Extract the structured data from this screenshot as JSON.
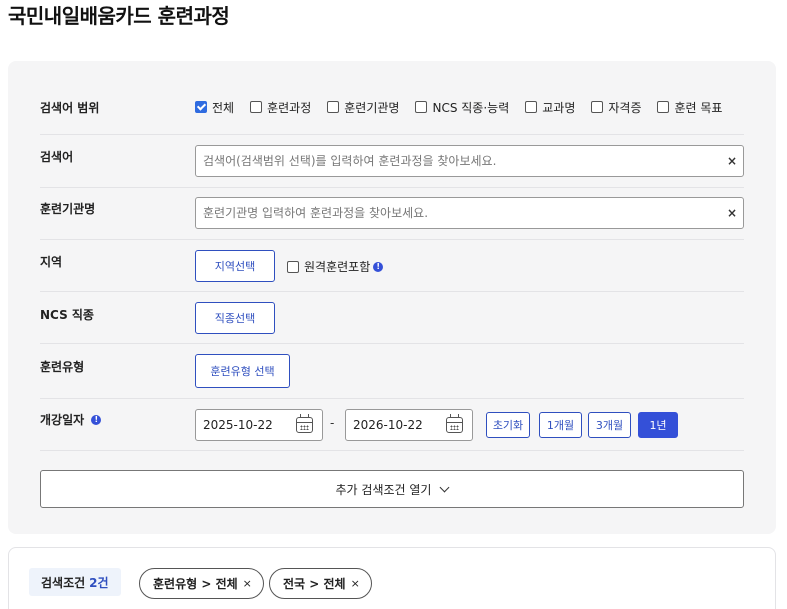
{
  "page_title": "국민내일배움카드 훈련과정",
  "search_scope": {
    "label": "검색어 범위",
    "options": [
      {
        "label": "전체",
        "checked": true
      },
      {
        "label": "훈련과정",
        "checked": false
      },
      {
        "label": "훈련기관명",
        "checked": false
      },
      {
        "label": "NCS 직종·능력",
        "checked": false
      },
      {
        "label": "교과명",
        "checked": false
      },
      {
        "label": "자격증",
        "checked": false
      },
      {
        "label": "훈련 목표",
        "checked": false
      }
    ]
  },
  "keyword": {
    "label": "검색어",
    "placeholder": "검색어(검색범위 선택)를 입력하여 훈련과정을 찾아보세요.",
    "value": "",
    "clear": "×"
  },
  "institution": {
    "label": "훈련기관명",
    "placeholder": "훈련기관명 입력하여 훈련과정을 찾아보세요.",
    "value": "",
    "clear": "×"
  },
  "region": {
    "label": "지역",
    "button": "지역선택",
    "remote_label": "원격훈련포함",
    "remote_checked": false,
    "info": "!"
  },
  "ncs": {
    "label": "NCS 직종",
    "button": "직종선택"
  },
  "training_type": {
    "label": "훈련유형",
    "button": "훈련유형 선택"
  },
  "start_date": {
    "label": "개강일자",
    "info": "!",
    "from": "2025-10-22",
    "separator": "-",
    "to": "2026-10-22",
    "periods": [
      "초기화",
      "1개월",
      "3개월",
      "1년"
    ],
    "active_period": "1년"
  },
  "more_conditions": {
    "label": "추가 검색조건 열기"
  },
  "result_conditions": {
    "label": "검색조건",
    "count": "2건",
    "chips": [
      "훈련유형 > 전체",
      "전국 > 전체"
    ],
    "chip_remove": "×"
  },
  "colors": {
    "accent": "#3450d8",
    "outline": "#2f4fbf",
    "panel_bg": "#f5f5f6"
  }
}
